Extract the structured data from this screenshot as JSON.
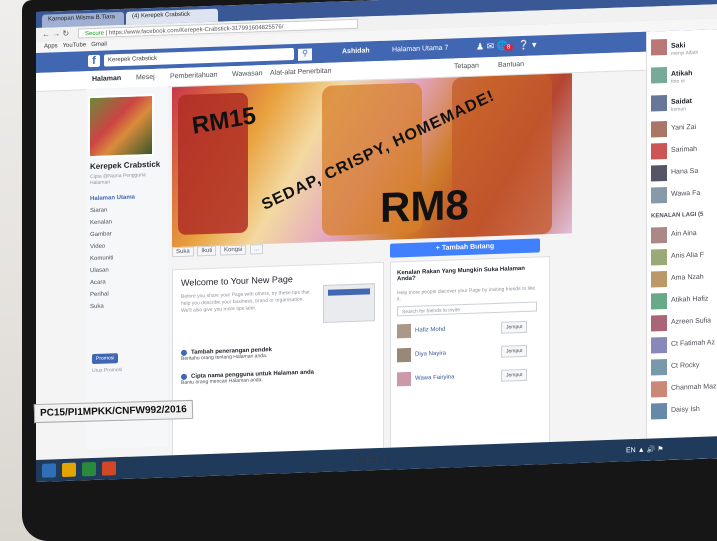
{
  "browser": {
    "tabs": [
      "Karnopan Wisma B.Tiara",
      "(4) Kerepek Crabstick"
    ],
    "url": "https://www.facebook.com/Kerepek-Crabstick-317991604825576/",
    "secure_label": "Secure",
    "bookmarks": [
      "Apps",
      "YouTube",
      "Gmail"
    ]
  },
  "fb_bar": {
    "search_value": "Kerepek Crabstick",
    "user_name": "Ashidah",
    "home_label": "Halaman Utama",
    "home_count": "7",
    "notif_count": "8"
  },
  "page_nav": {
    "items": [
      "Halaman",
      "Mesej",
      "Pemberitahuan",
      "Wawasan",
      "Alat-alat Penerbitan"
    ],
    "right": [
      "Tetapan",
      "Bantuan"
    ]
  },
  "left": {
    "page_name": "Kerepek Crabstick",
    "page_sub": "Cipta @Nama Pengguna Halaman",
    "menu": [
      "Halaman Utama",
      "Siaran",
      "Kenalan",
      "Gambar",
      "Video",
      "Komuniti",
      "Ulasan",
      "Acara",
      "Perihal",
      "Suka"
    ],
    "promote": "Promosi",
    "manage": "Urus Promosi"
  },
  "cover": {
    "price1": "RM15",
    "price2": "RM8",
    "tagline": "SEDAP, CRISPY, HOMEMADE!"
  },
  "actions": [
    "Suka",
    "Ikuti",
    "Kongsi",
    "..."
  ],
  "add_button": "+ Tambah Butang",
  "welcome": {
    "title": "Welcome to Your New Page",
    "desc": "Before you share your Page with others, try these tips that help you describe your business, brand or organisation. We'll also give you more tips later.",
    "steps": [
      {
        "title": "Tambah penerangan pendek",
        "desc": "Beritahu orang tentang Halaman anda."
      },
      {
        "title": "Cipta nama pengguna untuk Halaman anda",
        "desc": "Bantu orang mencari Halaman anda."
      }
    ]
  },
  "invite": {
    "title": "Kenalan Rakan Yang Mungkin Suka Halaman Anda?",
    "desc": "Help more people discover your Page by inviting friends to like it.",
    "search_placeholder": "Search for friends to invite",
    "friends": [
      {
        "name": "Hafiz Mohd",
        "button": "Jemput"
      },
      {
        "name": "Diya Nayira",
        "button": "Jemput"
      },
      {
        "name": "Wawa Fairyina",
        "button": "Jemput"
      }
    ]
  },
  "chat": {
    "top": [
      {
        "name": "Saki",
        "status": "menyi Alfath"
      },
      {
        "name": "Atikah",
        "status": "foto ol"
      },
      {
        "name": "Saidat",
        "status": "komun"
      }
    ],
    "online": [
      "Yani Zai",
      "Sarimah",
      "Hana Sa",
      "Wawa Fa"
    ],
    "section_label": "KENALAN LAGI (5",
    "more": [
      "Ain Aina",
      "Anis Alia F",
      "Ama Nzah",
      "Atikah Hafiz",
      "Azreen Sufia",
      "Ct Fatimah Az",
      "Ct Rocky",
      "Chanmah Maz",
      "Daisy Ish"
    ]
  },
  "taskbar": {
    "lang": "EN"
  },
  "monitor": {
    "brand": "DELL",
    "sticker": "PC15/PI1MPKK/CNFW992/2016"
  }
}
